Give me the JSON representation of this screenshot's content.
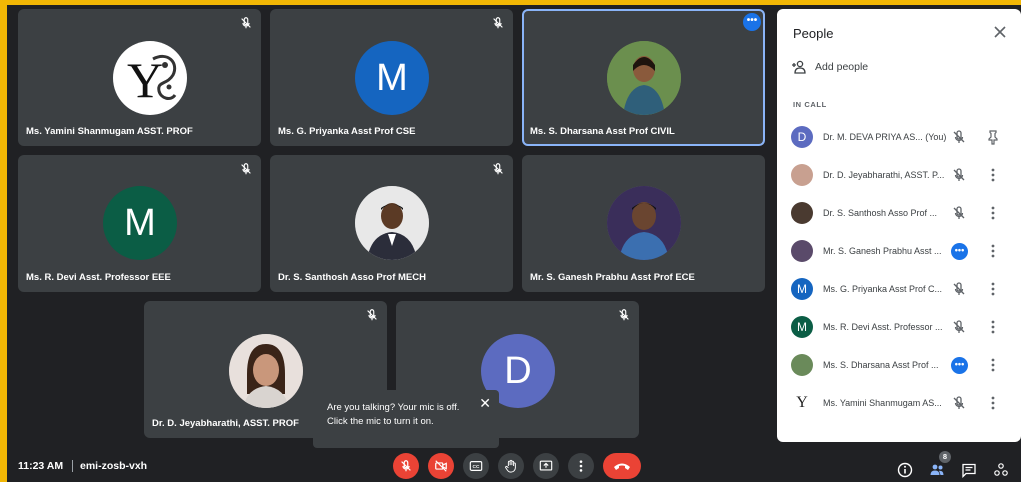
{
  "tiles": [
    {
      "name": "Ms. Yamini Shanmugam ASST. PROF",
      "avatar_letter": "Y"
    },
    {
      "name": "Ms. G. Priyanka Asst Prof CSE",
      "avatar_letter": "M"
    },
    {
      "name": "Ms. S. Dharsana Asst Prof CIVIL",
      "avatar_letter": ""
    },
    {
      "name": "Ms. R. Devi Asst. Professor EEE",
      "avatar_letter": "M"
    },
    {
      "name": "Dr. S. Santhosh Asso Prof MECH",
      "avatar_letter": ""
    },
    {
      "name": "Mr. S. Ganesh Prabhu Asst Prof ECE",
      "avatar_letter": ""
    },
    {
      "name": "Dr. D. Jeyabharathi, ASST. PROF",
      "avatar_letter": ""
    },
    {
      "name": "",
      "avatar_letter": "D"
    }
  ],
  "panel": {
    "title": "People",
    "add_people": "Add people",
    "in_call": "IN CALL",
    "people": [
      {
        "name": "Dr. M. DEVA PRIYA AS... (You)",
        "avatar_letter": "D",
        "avatar_color": "#5c6bc0",
        "status": "muted",
        "action": "pin-icon"
      },
      {
        "name": "Dr. D. Jeyabharathi, ASST. P...",
        "avatar_letter": "",
        "avatar_color": "#c8a090",
        "status": "muted",
        "action": "more-vert-icon"
      },
      {
        "name": "Dr. S. Santhosh Asso Prof ...",
        "avatar_letter": "",
        "avatar_color": "#4a3a30",
        "status": "muted",
        "action": "more-vert-icon"
      },
      {
        "name": "Mr. S. Ganesh Prabhu Asst ...",
        "avatar_letter": "",
        "avatar_color": "#5a4a6a",
        "status": "speaking",
        "action": "more-vert-icon"
      },
      {
        "name": "Ms. G. Priyanka Asst Prof C...",
        "avatar_letter": "M",
        "avatar_color": "#1565c0",
        "status": "muted",
        "action": "more-vert-icon"
      },
      {
        "name": "Ms. R. Devi Asst. Professor ...",
        "avatar_letter": "M",
        "avatar_color": "#0b5d45",
        "status": "muted",
        "action": "more-vert-icon"
      },
      {
        "name": "Ms. S. Dharsana Asst Prof ...",
        "avatar_letter": "",
        "avatar_color": "#6a8a5a",
        "status": "speaking",
        "action": "more-vert-icon"
      },
      {
        "name": "Ms. Yamini Shanmugam AS...",
        "avatar_letter": "Y",
        "avatar_color": "#ffffff",
        "status": "muted",
        "action": "more-vert-icon"
      }
    ]
  },
  "tooltip": {
    "line1": "Are you talking? Your mic is off.",
    "line2": "Click the mic to turn it on."
  },
  "bottom": {
    "time": "11:23 AM",
    "meeting_code": "emi-zosb-vxh",
    "participant_count": "8"
  },
  "colors": {
    "background": "#202124",
    "tile": "#3c4043",
    "accent_blue": "#1a73e8",
    "red": "#ea4335",
    "frame_border": "#f2b705"
  }
}
